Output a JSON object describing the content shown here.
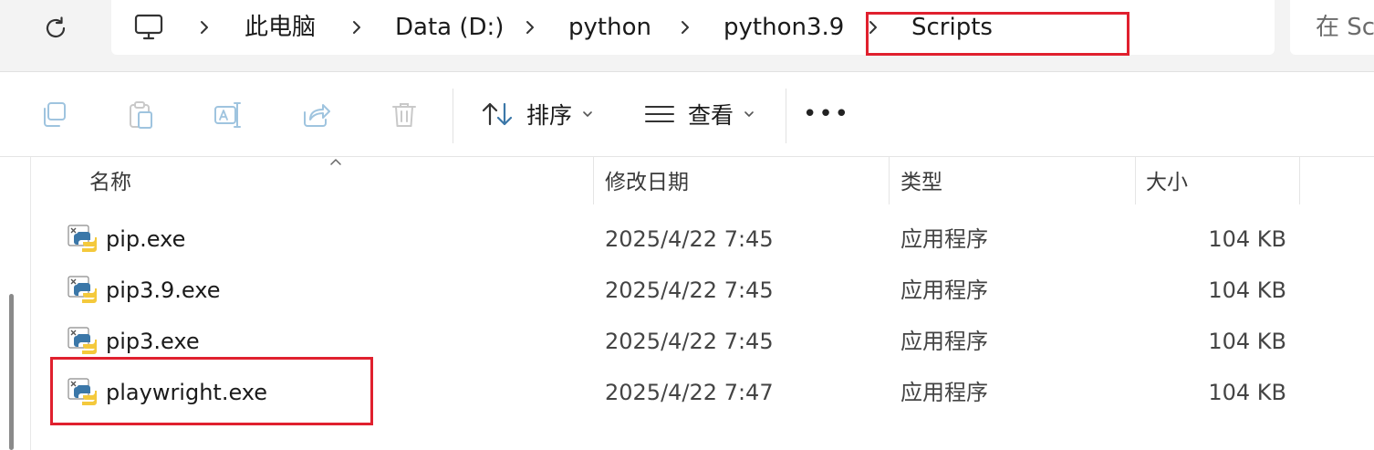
{
  "breadcrumb": {
    "items": [
      "此电脑",
      "Data (D:)",
      "python",
      "python3.9",
      "Scripts"
    ]
  },
  "search": {
    "placeholder_visible": "在 Sc"
  },
  "toolbar": {
    "sort_label": "排序",
    "view_label": "查看",
    "more_label": "•••"
  },
  "columns": {
    "name": "名称",
    "modified": "修改日期",
    "type": "类型",
    "size": "大小"
  },
  "files": [
    {
      "name": "pip.exe",
      "modified": "2025/4/22 7:45",
      "type": "应用程序",
      "size": "104 KB"
    },
    {
      "name": "pip3.9.exe",
      "modified": "2025/4/22 7:45",
      "type": "应用程序",
      "size": "104 KB"
    },
    {
      "name": "pip3.exe",
      "modified": "2025/4/22 7:45",
      "type": "应用程序",
      "size": "104 KB"
    },
    {
      "name": "playwright.exe",
      "modified": "2025/4/22 7:47",
      "type": "应用程序",
      "size": "104 KB"
    }
  ],
  "colors": {
    "highlight": "#e0202e",
    "icon_disabled": "#9fc4df",
    "python_blue": "#3b77a8",
    "python_yellow": "#f4c93c"
  }
}
